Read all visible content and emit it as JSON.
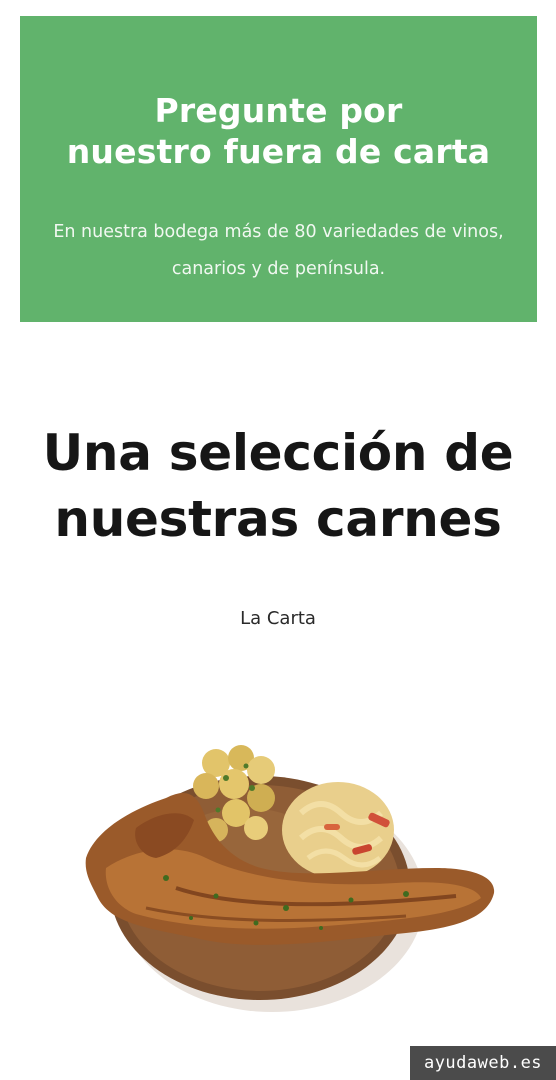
{
  "promo": {
    "title_line1": "Pregunte por",
    "title_line2": "nuestro fuera de carta",
    "text_line1": "En nuestra bodega más de 80 variedades de vinos,",
    "text_line2": "canarios y de península.",
    "background_color": "#61b36c"
  },
  "section": {
    "title_line1": "Una selección de",
    "title_line2": "nuestras carnes",
    "link_label": "La Carta"
  },
  "dish": {
    "icon": "grilled-chop-plate-image"
  },
  "watermark": {
    "label": "ayudaweb.es"
  }
}
